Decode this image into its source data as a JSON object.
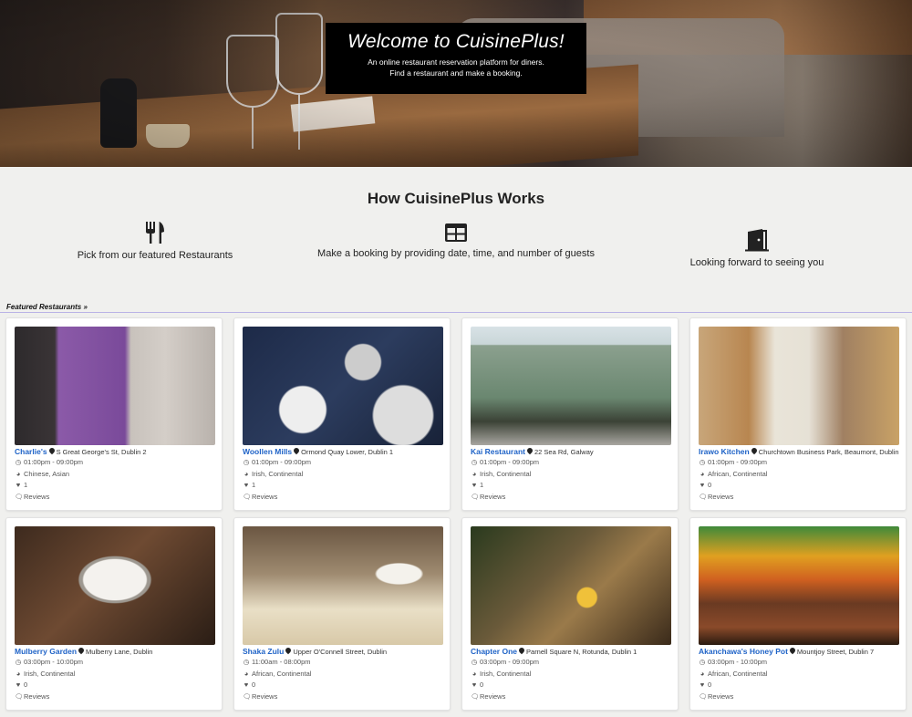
{
  "hero": {
    "title": "Welcome to CuisinePlus!",
    "line1": "An online restaurant reservation platform for diners.",
    "line2": "Find a restaurant and make a booking."
  },
  "how": {
    "title": "How CuisinePlus Works",
    "steps": [
      {
        "icon": "utensils-icon",
        "label": "Pick from our featured Restaurants"
      },
      {
        "icon": "table-icon",
        "label": "Make a booking by providing date, time, and number of guests"
      },
      {
        "icon": "door-icon",
        "label": "Looking forward to seeing you"
      }
    ]
  },
  "featured_label": "Featured Restaurants »",
  "restaurants": [
    {
      "name": "Charlie's",
      "address": "S Great George's St, Dublin 2",
      "hours": "01:00pm - 09:00pm",
      "cuisine": "Chinese, Asian",
      "likes": "1",
      "reviews": "Reviews"
    },
    {
      "name": "Woollen Mills",
      "address": "Ormond Quay Lower, Dublin 1",
      "hours": "01:00pm - 09:00pm",
      "cuisine": "Irish, Continental",
      "likes": "1",
      "reviews": "Reviews"
    },
    {
      "name": "Kai Restaurant",
      "address": "22 Sea Rd, Galway",
      "hours": "01:00pm - 09:00pm",
      "cuisine": "Irish, Continental",
      "likes": "1",
      "reviews": "Reviews"
    },
    {
      "name": "Irawo Kitchen",
      "address": "Churchtown Business Park, Beaumont, Dublin",
      "hours": "01:00pm - 09:00pm",
      "cuisine": "African, Continental",
      "likes": "0",
      "reviews": "Reviews"
    },
    {
      "name": "Mulberry Garden",
      "address": "Mulberry Lane, Dublin",
      "hours": "03:00pm - 10:00pm",
      "cuisine": "Irish, Continental",
      "likes": "0",
      "reviews": "Reviews"
    },
    {
      "name": "Shaka Zulu",
      "address": "Upper O'Connell Street, Dublin",
      "hours": "11:00am - 08:00pm",
      "cuisine": "African, Continental",
      "likes": "0",
      "reviews": "Reviews"
    },
    {
      "name": "Chapter One",
      "address": "Parnell Square N, Rotunda, Dublin 1",
      "hours": "03:00pm - 09:00pm",
      "cuisine": "Irish, Continental",
      "likes": "0",
      "reviews": "Reviews"
    },
    {
      "name": "Akanchawa's Honey Pot",
      "address": "Mountjoy Street, Dublin 7",
      "hours": "03:00pm - 10:00pm",
      "cuisine": "African, Continental",
      "likes": "0",
      "reviews": "Reviews"
    }
  ],
  "colors": {
    "link": "#1f63c7",
    "hero_box": "#000000",
    "page_bg": "#f0f0ee"
  }
}
